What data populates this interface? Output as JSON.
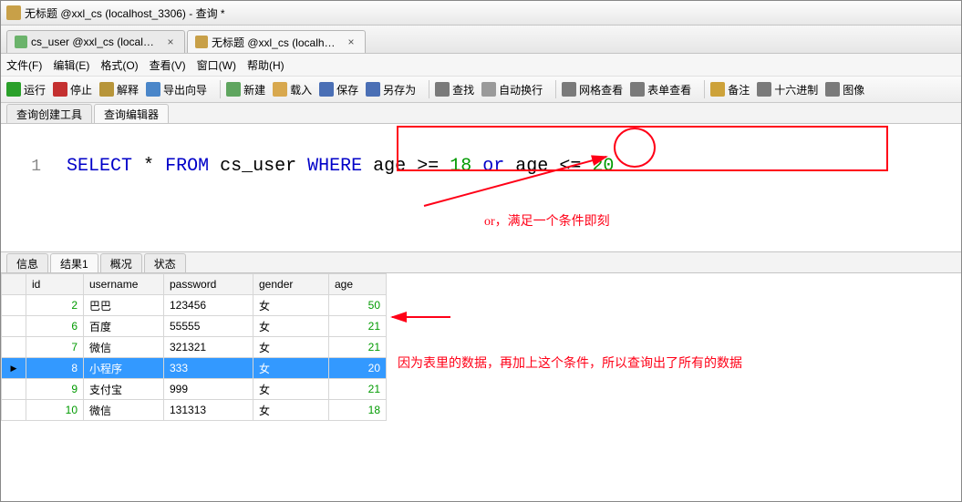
{
  "title": "无标题 @xxl_cs (localhost_3306) - 查询 *",
  "tabs": [
    {
      "label": "cs_user @xxl_cs (localho...",
      "active": false
    },
    {
      "label": "无标题 @xxl_cs (localho...",
      "active": true
    }
  ],
  "menus": [
    "文件(F)",
    "编辑(E)",
    "格式(O)",
    "查看(V)",
    "窗口(W)",
    "帮助(H)"
  ],
  "toolbar": {
    "run": "运行",
    "stop": "停止",
    "explain": "解释",
    "export": "导出向导",
    "new": "新建",
    "load": "载入",
    "save": "保存",
    "saveas": "另存为",
    "find": "查找",
    "wrap": "自动换行",
    "gridview": "网格查看",
    "formview": "表单查看",
    "comment": "备注",
    "hex": "十六进制",
    "image": "图像"
  },
  "subtabs": [
    "查询创建工具",
    "查询编辑器"
  ],
  "sql": {
    "line_number": "1",
    "select": "SELECT",
    "star": "*",
    "from": "FROM",
    "table": "cs_user",
    "where": "WHERE",
    "col1": "age",
    "op1": ">=",
    "n1": "18",
    "or": "or",
    "col2": "age",
    "op2": "<=",
    "n2": "20"
  },
  "annotations": {
    "or_note": "or，满足一个条件即刻",
    "result_note": "因为表里的数据，再加上这个条件，所以查询出了所有的数据"
  },
  "result_tabs": [
    "信息",
    "结果1",
    "概况",
    "状态"
  ],
  "columns": [
    "id",
    "username",
    "password",
    "gender",
    "age"
  ],
  "rows": [
    {
      "id": 2,
      "username": "巴巴",
      "password": "123456",
      "gender": "女",
      "age": 50,
      "selected": false
    },
    {
      "id": 6,
      "username": "百度",
      "password": "55555",
      "gender": "女",
      "age": 21,
      "selected": false
    },
    {
      "id": 7,
      "username": "微信",
      "password": "321321",
      "gender": "女",
      "age": 21,
      "selected": false
    },
    {
      "id": 8,
      "username": "小程序",
      "password": "333",
      "gender": "女",
      "age": 20,
      "selected": true
    },
    {
      "id": 9,
      "username": "支付宝",
      "password": "999",
      "gender": "女",
      "age": 21,
      "selected": false
    },
    {
      "id": 10,
      "username": "微信",
      "password": "131313",
      "gender": "女",
      "age": 18,
      "selected": false
    }
  ]
}
